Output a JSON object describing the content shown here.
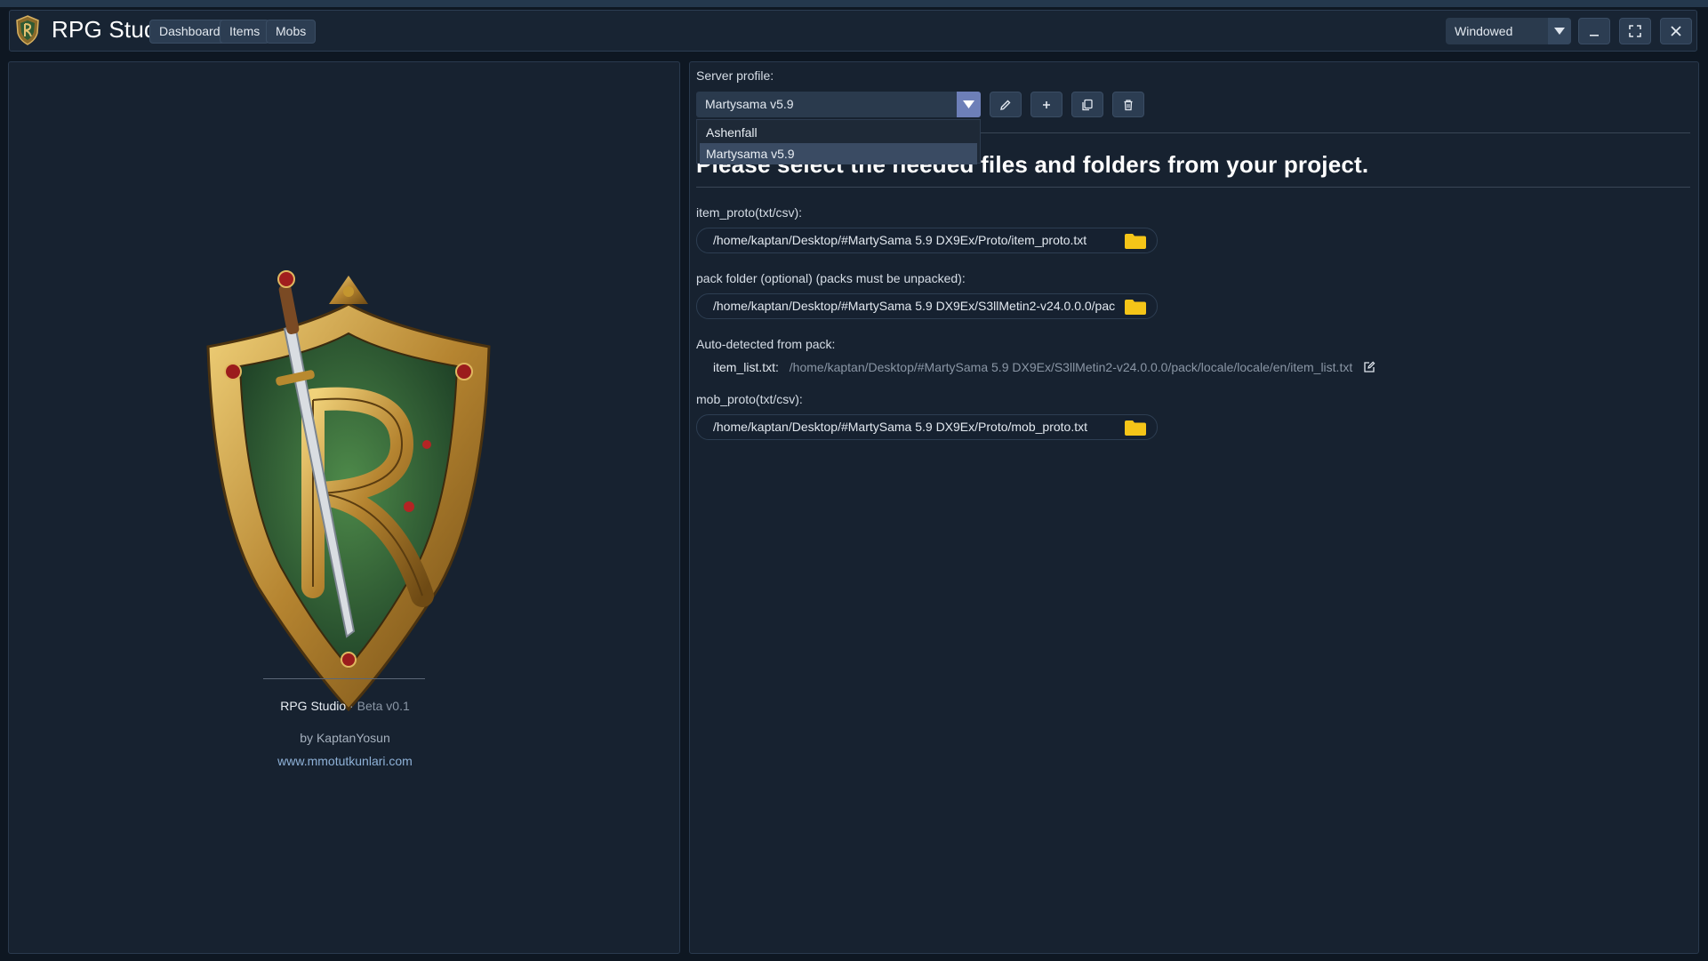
{
  "app": {
    "title": "RPG Studio",
    "nav": [
      "Dashboard",
      "Items",
      "Mobs"
    ],
    "window_mode": "Windowed"
  },
  "about": {
    "name": "RPG Studio",
    "separator": "·",
    "version": "Beta v0.1",
    "author": "by KaptanYosun",
    "website": "www.mmotutkunlari.com"
  },
  "profile": {
    "label": "Server profile:",
    "selected": "Martysama v5.9",
    "options": [
      "Ashenfall",
      "Martysama v5.9"
    ],
    "highlighted_index": 1
  },
  "main": {
    "heading": "Please select the needed files and folders from your project.",
    "item_proto_label": "item_proto(txt/csv):",
    "item_proto_path": "/home/kaptan/Desktop/#MartySama 5.9 DX9Ex/Proto/item_proto.txt",
    "pack_label": "pack folder (optional) (packs must be unpacked):",
    "pack_path": "/home/kaptan/Desktop/#MartySama 5.9 DX9Ex/S3llMetin2-v24.0.0.0/pac",
    "autodetect_label": "Auto-detected from pack:",
    "item_list_key": "item_list.txt:",
    "item_list_path": "/home/kaptan/Desktop/#MartySama 5.9 DX9Ex/S3llMetin2-v24.0.0.0/pack/locale/locale/en/item_list.txt",
    "mob_proto_label": "mob_proto(txt/csv):",
    "mob_proto_path": "/home/kaptan/Desktop/#MartySama 5.9 DX9Ex/Proto/mob_proto.txt"
  },
  "icons": {
    "app": "shield-crest-icon",
    "dropdown": "chevron-down-icon",
    "minimize": "minimize-icon",
    "maximize": "maximize-icon",
    "close": "close-icon",
    "edit": "pencil-icon",
    "add": "plus-icon",
    "copy": "copy-icon",
    "delete": "trash-icon",
    "folder": "folder-icon",
    "external_edit": "edit-external-icon"
  },
  "colors": {
    "background": "#0e1722",
    "panel": "#172230",
    "button": "#2c3d52",
    "accent": "#6d7fb8",
    "folder": "#f5c518",
    "link": "#8fb2d8",
    "muted": "#8a96a5"
  }
}
